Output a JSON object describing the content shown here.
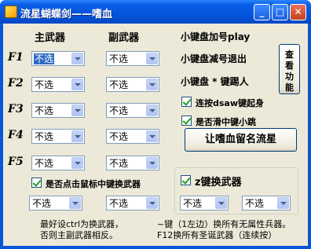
{
  "window": {
    "title": "流星蝴蝶剑——嗜血",
    "minimize_glyph": "_",
    "maximize_glyph": "□",
    "close_glyph": "✕"
  },
  "headers": {
    "primary": "主武器",
    "secondary": "副武器"
  },
  "rows": [
    {
      "key": "F1",
      "primary": "不选",
      "secondary": "不选"
    },
    {
      "key": "F2",
      "primary": "不选",
      "secondary": "不选"
    },
    {
      "key": "F3",
      "primary": "不选",
      "secondary": "不选"
    },
    {
      "key": "F4",
      "primary": "不选",
      "secondary": "不选"
    },
    {
      "key": "F5",
      "primary": "不选",
      "secondary": "不选"
    }
  ],
  "right_panel": {
    "numpad_plus": "小键盘加号play",
    "numpad_minus": "小键盘减号退出",
    "numpad_star": "小键盘 * 键踢人",
    "view_button": [
      "查",
      "看",
      "功",
      "能"
    ],
    "dsaw_checkbox": {
      "label": "连按dsaw键起身",
      "checked": true
    },
    "mid_button_checkbox": {
      "label": "是否滑中键小跳",
      "checked": true
    },
    "name_button": "让嗜血留名流星"
  },
  "mouse_switch": {
    "label": "是否点击鼠标中键换武器",
    "checked": true,
    "left_value": "不选",
    "right_value": "不选"
  },
  "z_switch": {
    "label": "z键换武器",
    "checked": true,
    "left_value": "不选",
    "right_value": "不选"
  },
  "notes": {
    "left_line1": "最好设ctrl为换武器，",
    "left_line2": "否则主副武器相反。",
    "right_line1": "~键（1左边）换所有无属性兵器。",
    "right_line2": "F12换所有圣诞武器（连续按）"
  }
}
